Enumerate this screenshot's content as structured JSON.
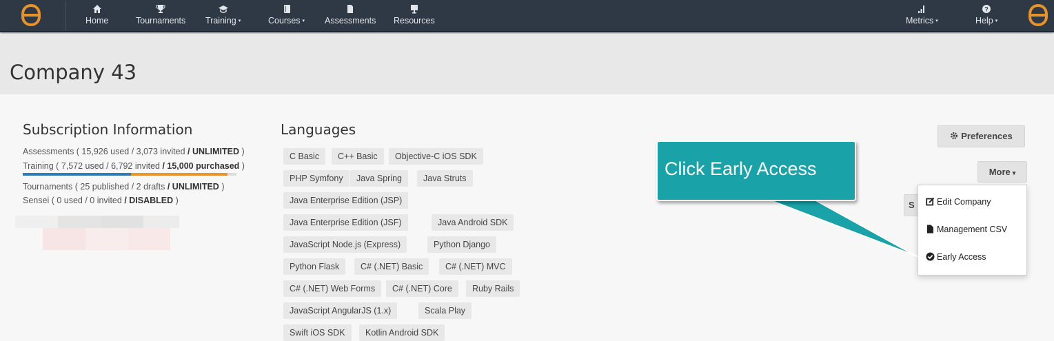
{
  "nav": {
    "items": [
      {
        "label": "Home",
        "icon": "home-icon"
      },
      {
        "label": "Tournaments",
        "icon": "trophy-icon"
      },
      {
        "label": "Training",
        "icon": "graduation-cap-icon",
        "caret": "▾"
      },
      {
        "label": "Courses",
        "icon": "book-icon",
        "caret": "▾"
      },
      {
        "label": "Assessments",
        "icon": "file-icon"
      },
      {
        "label": "Resources",
        "icon": "presentation-icon"
      }
    ],
    "right_items": [
      {
        "label": "Metrics",
        "icon": "signal-bars-icon",
        "caret": "▾"
      },
      {
        "label": "Help",
        "icon": "question-circle-icon",
        "caret": "▾"
      }
    ],
    "brand_color": "#e8922a"
  },
  "page": {
    "title": "Company 43"
  },
  "subscription": {
    "heading": "Subscription Information",
    "assessments": {
      "prefix": "Assessments ( 15,926 used / 3,073 invited ",
      "bold": "/ UNLIMITED",
      "suffix": " )"
    },
    "training": {
      "prefix": "Training ( 7,572 used / 6,792 invited ",
      "bold": "/ 15,000 purchased",
      "suffix": " )"
    },
    "tournaments": {
      "prefix": "Tournaments ( 25 published / 2 drafts ",
      "bold": "/ UNLIMITED",
      "suffix": " )"
    },
    "sensei": {
      "prefix": "Sensei ( 0 used / 0 invited ",
      "bold": "/ DISABLED",
      "suffix": " )"
    },
    "training_used_fraction": 0.505,
    "training_invited_fraction": 0.453
  },
  "languages": {
    "heading": "Languages",
    "rows": [
      [
        "C Basic",
        "C++ Basic",
        "Objective-C iOS SDK"
      ],
      [
        "PHP Symfony",
        "Java Spring",
        "Java Struts"
      ],
      [
        "Java Enterprise Edition (JSP)"
      ],
      [
        "Java Enterprise Edition (JSF)",
        "Java Android SDK"
      ],
      [
        "JavaScript Node.js (Express)",
        "Python Django"
      ],
      [
        "Python Flask",
        "C# (.NET) Basic",
        "C# (.NET) MVC"
      ],
      [
        "C# (.NET) Web Forms",
        "C# (.NET) Core",
        "Ruby Rails"
      ],
      [
        "JavaScript AngularJS (1.x)",
        "Scala Play"
      ],
      [
        "Swift iOS SDK",
        "Kotlin Android SDK"
      ]
    ]
  },
  "actions": {
    "preferences_label": "Preferences",
    "more_label": "More",
    "more_caret": "▾",
    "hidden_button_label": "S",
    "menu": [
      {
        "label": "Edit Company",
        "icon": "edit-icon"
      },
      {
        "label": "Management CSV",
        "icon": "file-icon"
      },
      {
        "label": "Early Access",
        "icon": "check-circle-icon"
      }
    ]
  },
  "callout": {
    "text": "Click Early Access",
    "color": "#19a3a8"
  }
}
